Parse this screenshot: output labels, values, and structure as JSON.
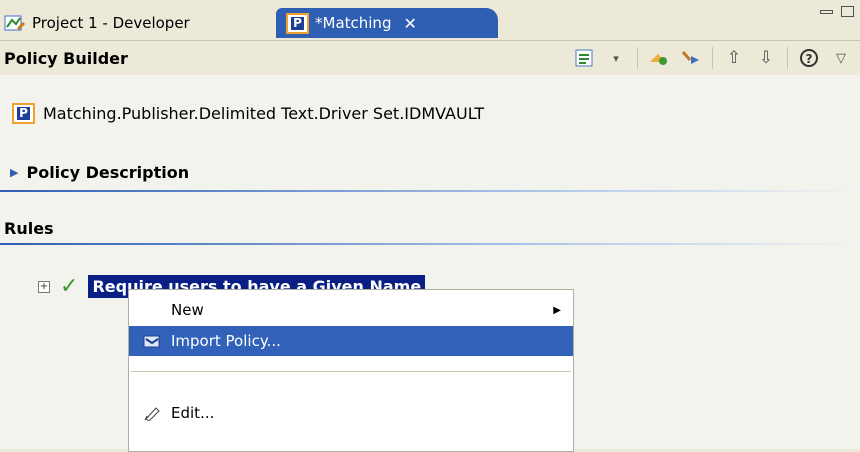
{
  "tabs": [
    {
      "label": "Project 1 - Developer",
      "icon": "project-icon"
    },
    {
      "label": "*Matching",
      "icon": "policy-icon",
      "active": true,
      "close_glyph": "✕"
    }
  ],
  "header": {
    "title": "Policy Builder"
  },
  "policy": {
    "path": "Matching.Publisher.Delimited Text.Driver Set.IDMVAULT",
    "icon_glyph": "P"
  },
  "sections": {
    "description": "Policy Description",
    "rules": "Rules"
  },
  "rule": {
    "label": "Require users to have a Given Name",
    "expander_glyph": "+",
    "status_glyph": "✓"
  },
  "context_menu": {
    "items": [
      {
        "label": "New",
        "has_submenu": true
      },
      {
        "label": "Import Policy...",
        "highlighted": true
      },
      {
        "label": "Edit..."
      }
    ]
  },
  "colors": {
    "accent": "#2f5fb3",
    "selection": "#0a1f84",
    "menu_highlight": "#3161b8"
  }
}
